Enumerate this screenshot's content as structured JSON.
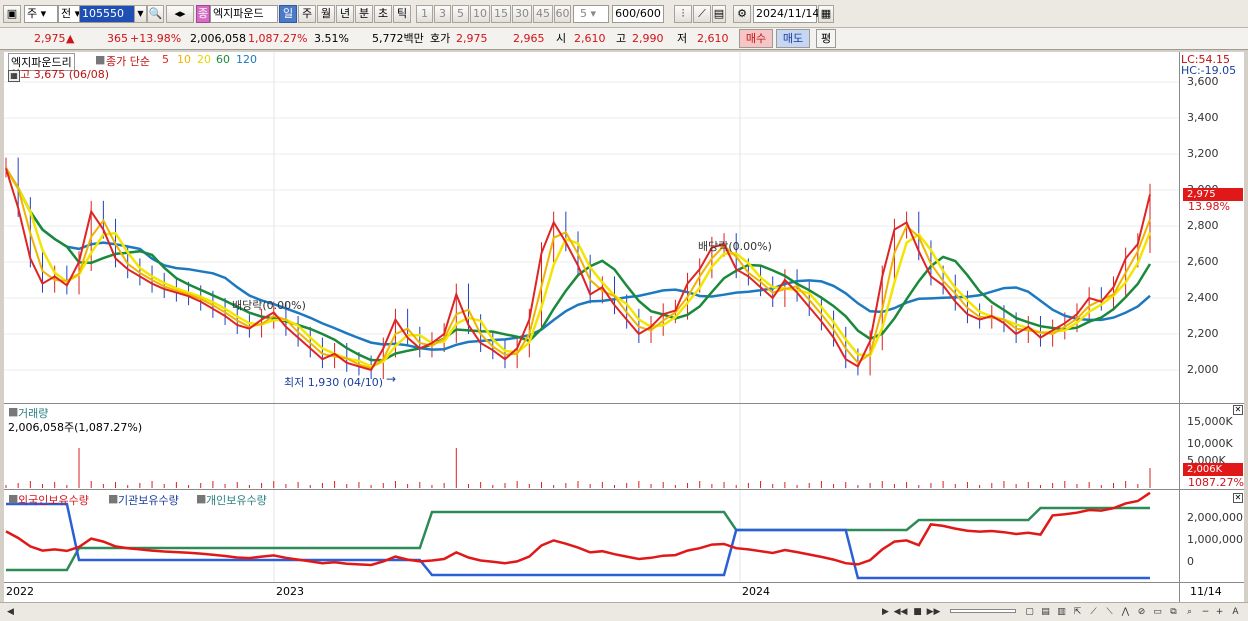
{
  "toolbar": {
    "unit1": "주",
    "market": "전",
    "code": "105550",
    "name_badge": "종",
    "stock_name": "엑지파운드",
    "periods": [
      "일",
      "주",
      "월",
      "년",
      "분",
      "초",
      "틱"
    ],
    "active_period": "일",
    "intervals": [
      "1",
      "3",
      "5",
      "10",
      "15",
      "30",
      "45",
      "60"
    ],
    "interval_value": "5",
    "count": "600",
    "count_total": "/600",
    "date": "2024/11/14"
  },
  "quote": {
    "price": "2,975",
    "change_arrow": "▲",
    "change": "365",
    "change_pct": "+13.98%",
    "volume": "2,006,058",
    "volume_pct": "1,087.27%",
    "turnover": "3.51%",
    "amount": "5,772백만",
    "ask_label": "호가",
    "ask": "2,975",
    "bid": "2,965",
    "open_label": "시",
    "open": "2,610",
    "high_label": "고",
    "high": "2,990",
    "low_label": "저",
    "low": "2,610",
    "buy": "매수",
    "sell": "매도",
    "avg": "평"
  },
  "price_pane": {
    "stock_tag": "엑지파운드리",
    "legend_label": "종가 단순",
    "ma_labels": [
      "5",
      "10",
      "20",
      "60",
      "120"
    ],
    "ma_colors": [
      "#e02424",
      "#f0b400",
      "#f2e600",
      "#1a8a3a",
      "#1c79c0"
    ],
    "high_note": "최고 3,675 (06/08)",
    "low_note": "최저 1,930 (04/10)",
    "div_note1": "배당락(0.00%)",
    "div_note2": "배당락(0.00%)",
    "lc": "LC:54.15",
    "hc": "HC:-19.05",
    "y_ticks": [
      "3,600",
      "3,400",
      "3,200",
      "3,000",
      "2,800",
      "2,600",
      "2,400",
      "2,200",
      "2,000"
    ],
    "last_price": "2,975",
    "last_pct": "13.98%"
  },
  "volume_pane": {
    "title": "거래량",
    "info": "2,006,058주(1,087.27%)",
    "y_ticks": [
      "15,000K",
      "10,000K",
      "5,000K"
    ],
    "last_vol": "2,006K",
    "last_pct": "1087.27%"
  },
  "holding_pane": {
    "legend": [
      "외국인보유수량",
      "기관보유수량",
      "개인보유수량"
    ],
    "colors": [
      "#e01818",
      "#2a5fd6",
      "#2e8b57"
    ],
    "y_ticks": [
      "2,000,000",
      "1,000,000",
      "0"
    ]
  },
  "x_axis": {
    "labels": [
      "2022",
      "2023",
      "2024"
    ],
    "last_date": "11/14"
  },
  "chart_data": {
    "type": "line",
    "ylim": [
      1930,
      3675
    ],
    "close": [
      3120,
      2900,
      2620,
      2480,
      2520,
      2470,
      2600,
      2880,
      2780,
      2620,
      2560,
      2520,
      2480,
      2450,
      2430,
      2410,
      2380,
      2340,
      2300,
      2250,
      2230,
      2280,
      2320,
      2240,
      2180,
      2120,
      2060,
      2090,
      2040,
      2020,
      2000,
      2120,
      2280,
      2180,
      2120,
      2150,
      2200,
      2420,
      2250,
      2150,
      2110,
      2060,
      2120,
      2280,
      2650,
      2820,
      2710,
      2580,
      2420,
      2460,
      2360,
      2280,
      2200,
      2240,
      2310,
      2330,
      2480,
      2560,
      2680,
      2700,
      2560,
      2520,
      2460,
      2400,
      2500,
      2430,
      2350,
      2270,
      2180,
      2060,
      2020,
      2160,
      2520,
      2780,
      2820,
      2660,
      2520,
      2470,
      2380,
      2310,
      2280,
      2300,
      2260,
      2200,
      2240,
      2180,
      2220,
      2260,
      2310,
      2400,
      2380,
      2460,
      2620,
      2700,
      2975
    ]
  }
}
